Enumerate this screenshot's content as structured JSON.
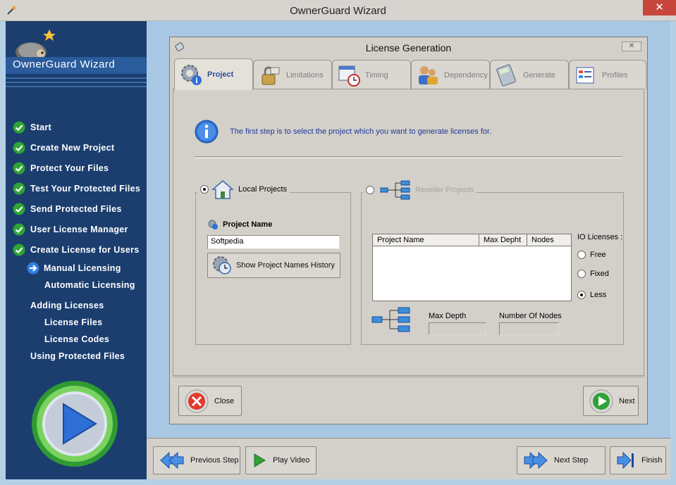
{
  "window": {
    "title": "OwnerGuard Wizard",
    "close_label": "✕"
  },
  "sidebar": {
    "brand": "OwnerGuard Wizard",
    "steps": [
      {
        "label": "Start"
      },
      {
        "label": "Create New Project"
      },
      {
        "label": "Protect Your Files"
      },
      {
        "label": "Test Your Protected Files"
      },
      {
        "label": "Send Protected Files"
      },
      {
        "label": "User License Manager"
      },
      {
        "label": "Create License for Users"
      }
    ],
    "sub": {
      "manual": "Manual Licensing",
      "automatic": "Automatic Licensing",
      "adding": "Adding Licenses",
      "license_files": "License Files",
      "license_codes": "License Codes",
      "using": "Using Protected Files"
    }
  },
  "dialog": {
    "title": "License Generation",
    "tabs": [
      {
        "label": "Project"
      },
      {
        "label": "Limitations"
      },
      {
        "label": "Timing"
      },
      {
        "label": "Dependency"
      },
      {
        "label": "Generate"
      },
      {
        "label": "Profiles"
      }
    ],
    "info": "The first step is to select the project which you want to generate licenses for.",
    "local": {
      "legend": "Local Projects",
      "project_name_label": "Project Name",
      "project_name_value": "Softpedia",
      "history_button": "Show Project Names History"
    },
    "reseller": {
      "legend": "Reseller Projects",
      "columns": [
        "Project Name",
        "Max Depht",
        "Nodes"
      ],
      "io_licenses_label": "IO Licenses :",
      "options": [
        "Free",
        "Fixed",
        "Less"
      ],
      "max_depth_label": "Max Depth",
      "number_of_nodes_label": "Number Of Nodes"
    },
    "close_button": "Close",
    "next_button": "Next"
  },
  "footer": {
    "previous": "Previous Step",
    "play": "Play Video",
    "next": "Next Step",
    "finish": "Finish"
  }
}
